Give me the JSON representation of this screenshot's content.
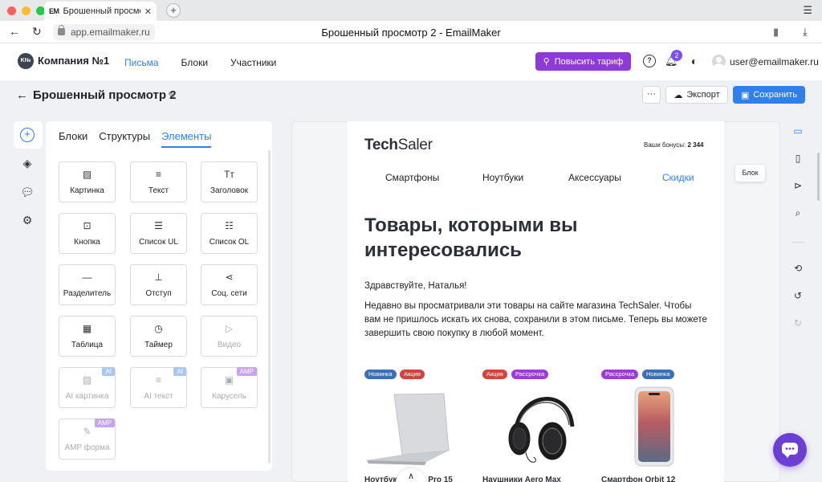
{
  "browser": {
    "tab_favicon": "EM",
    "tab_title": "Брошенный просмотр 2",
    "url": "app.emailmaker.ru",
    "page_title": "Брошенный просмотр 2 - EmailMaker"
  },
  "header": {
    "logo_text": "K№",
    "company": "Компания №1",
    "nav": [
      "Письма",
      "Блоки",
      "Участники"
    ],
    "upgrade_label": "Повысить тариф",
    "notification_count": "2",
    "user_email": "user@emailmaker.ru"
  },
  "document": {
    "title": "Брошенный просмотр 2",
    "more_label": "···",
    "export_label": "Экспорт",
    "save_label": "Сохранить"
  },
  "panel": {
    "tabs": [
      "Блоки",
      "Структуры",
      "Элементы"
    ],
    "active_tab": "Элементы",
    "tiles": [
      {
        "label": "Картинка",
        "icon": "image-icon",
        "glyph": "▨"
      },
      {
        "label": "Текст",
        "icon": "text-icon",
        "glyph": "≡"
      },
      {
        "label": "Заголовок",
        "icon": "heading-icon",
        "glyph": "Tт"
      },
      {
        "label": "Кнопка",
        "icon": "button-icon",
        "glyph": "⊡"
      },
      {
        "label": "Список UL",
        "icon": "list-ul-icon",
        "glyph": "☰"
      },
      {
        "label": "Список OL",
        "icon": "list-ol-icon",
        "glyph": "☷"
      },
      {
        "label": "Разделитель",
        "icon": "divider-icon",
        "glyph": "—"
      },
      {
        "label": "Отступ",
        "icon": "spacer-icon",
        "glyph": "⊥"
      },
      {
        "label": "Соц. сети",
        "icon": "share-icon",
        "glyph": "⋖"
      },
      {
        "label": "Таблица",
        "icon": "table-icon",
        "glyph": "▦"
      },
      {
        "label": "Таймер",
        "icon": "clock-icon",
        "glyph": "◷"
      },
      {
        "label": "Видео",
        "icon": "video-icon",
        "glyph": "▷",
        "disabled": true
      },
      {
        "label": "AI картинка",
        "icon": "ai-image-icon",
        "glyph": "▨",
        "disabled": true,
        "tag": "AI"
      },
      {
        "label": "AI текст",
        "icon": "ai-text-icon",
        "glyph": "≡",
        "disabled": true,
        "tag": "AI"
      },
      {
        "label": "Карусель",
        "icon": "carousel-icon",
        "glyph": "▣",
        "disabled": true,
        "tag": "AMP"
      },
      {
        "label": "AMP форма",
        "icon": "form-icon",
        "glyph": "✎",
        "disabled": true,
        "tag": "AMP"
      }
    ]
  },
  "email": {
    "brand_bold": "Tech",
    "brand_light": "Saler",
    "bonus_label": "Ваши бонусы:",
    "bonus_value": "2 344",
    "nav": [
      "Смартфоны",
      "Ноутбуки",
      "Аксессуары",
      "Скидки"
    ],
    "headline": "Товары, которыми вы интересовались",
    "greeting": "Здравствуйте, Наталья!",
    "body": "Недавно вы просматривали эти товары на сайте магазина TechSaler. Чтобы вам не пришлось искать их снова, сохранили в этом письме. Теперь вы можете завершить свою покупку в любой момент.",
    "block_tooltip": "Блок",
    "products": [
      {
        "tags": [
          "Новинка",
          "Акция"
        ],
        "image": "laptop",
        "title": "Ноутбук Nebula Pro 15"
      },
      {
        "tags": [
          "Акция",
          "Рассрочка"
        ],
        "image": "headphones",
        "title": "Наушники Aero Max"
      },
      {
        "tags": [
          "Рассрочка",
          "Новинка"
        ],
        "image": "smartphone",
        "title": "Смартфон Orbit 12"
      }
    ]
  },
  "colors": {
    "accent": "#2f80ed",
    "upgrade": "#8e3ad9",
    "chat": "#6b3fd4",
    "tag_new": "#3d6fb6",
    "tag_sale": "#d0443b",
    "tag_installment": "#9c3bd6"
  }
}
